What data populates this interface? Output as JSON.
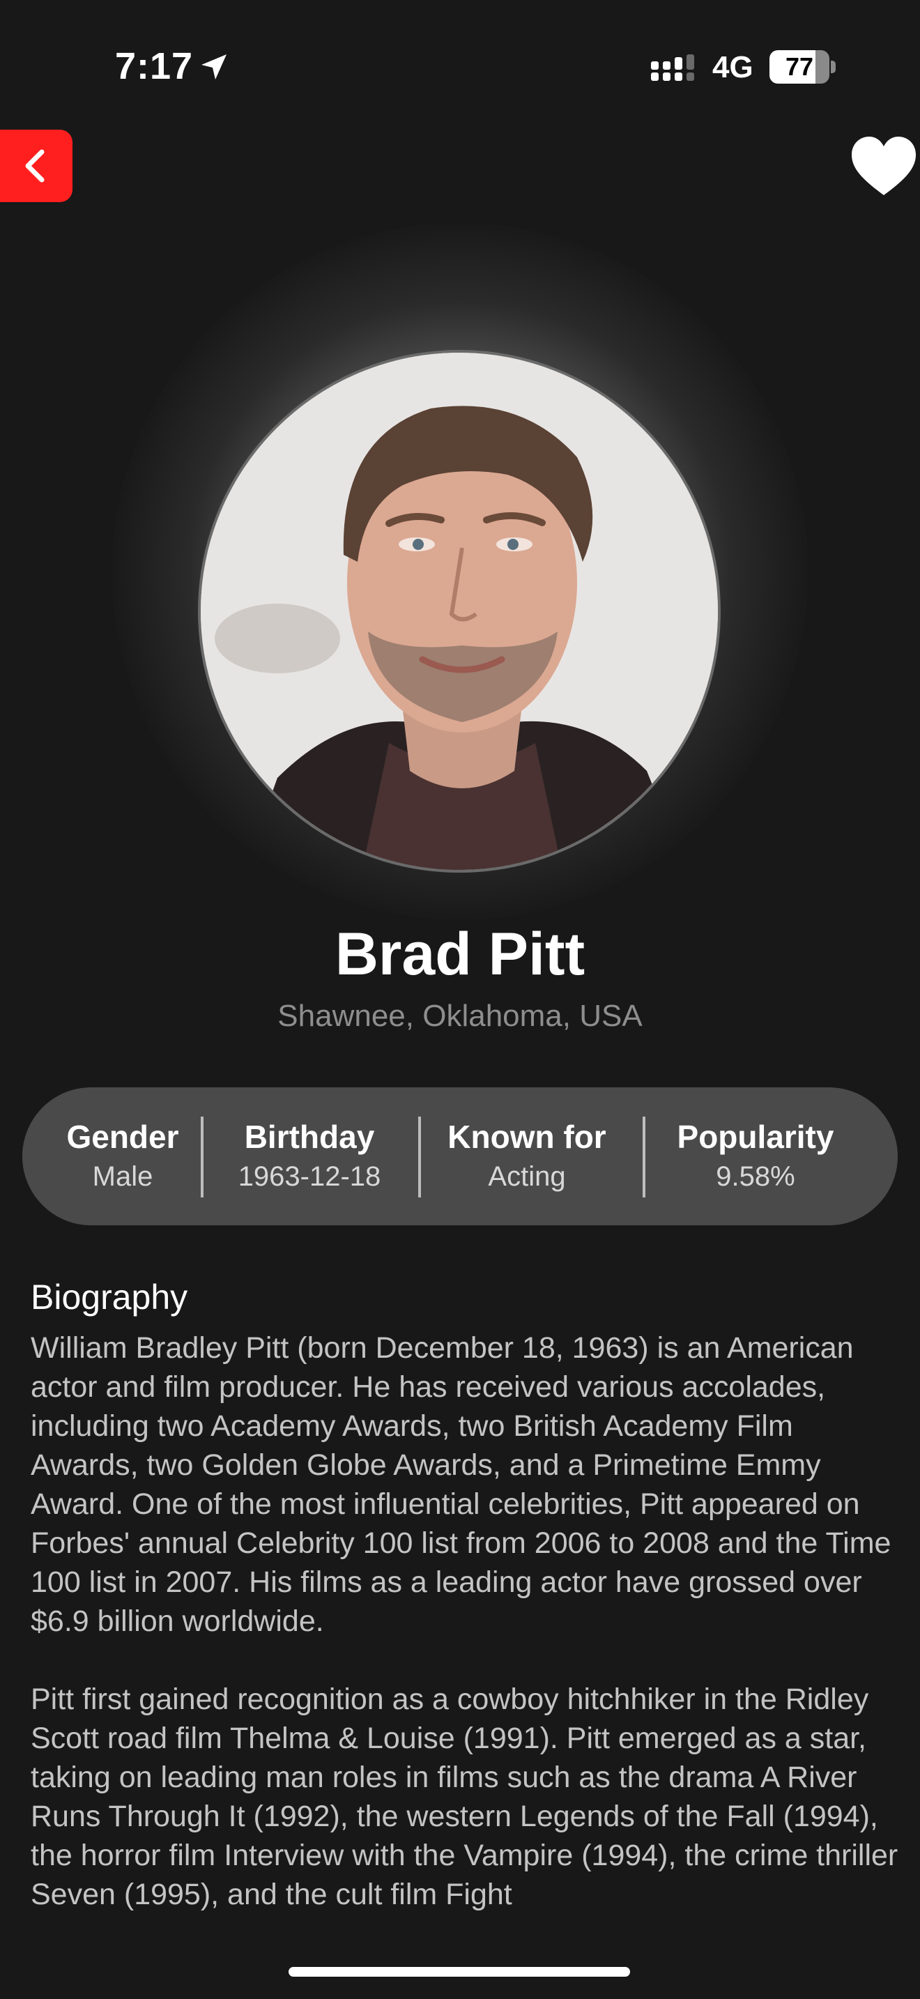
{
  "status_bar": {
    "time": "7:17",
    "network": "4G",
    "battery_level": 77,
    "battery_text": "77"
  },
  "header": {
    "back_icon": "chevron-left-icon",
    "favorite_icon": "heart-icon",
    "accent_color": "#ff1f1f"
  },
  "profile": {
    "name": "Brad Pitt",
    "birthplace": "Shawnee, Oklahoma, USA"
  },
  "stats": [
    {
      "label": "Gender",
      "value": "Male"
    },
    {
      "label": "Birthday",
      "value": "1963-12-18"
    },
    {
      "label": "Known for",
      "value": "Acting"
    },
    {
      "label": "Popularity",
      "value": "9.58%"
    }
  ],
  "biography": {
    "title": "Biography",
    "paragraphs": [
      "William Bradley Pitt (born December 18, 1963) is an American actor and film producer. He has received various accolades, including two Academy Awards, two British Academy Film Awards, two Golden Globe Awards, and a Primetime Emmy Award. One of the most influential celebrities, Pitt appeared on Forbes' annual Celebrity 100 list from 2006 to 2008 and the Time 100 list in 2007. His films as a leading actor have grossed over $6.9 billion worldwide.",
      "Pitt first gained recognition as a cowboy hitchhiker in the Ridley Scott road film Thelma & Louise (1991). Pitt emerged as a star, taking on leading man roles in films such as the drama A River Runs Through It (1992), the western Legends of the Fall (1994), the horror film Interview with the Vampire (1994), the crime thriller Seven (1995), and the cult film Fight"
    ]
  }
}
